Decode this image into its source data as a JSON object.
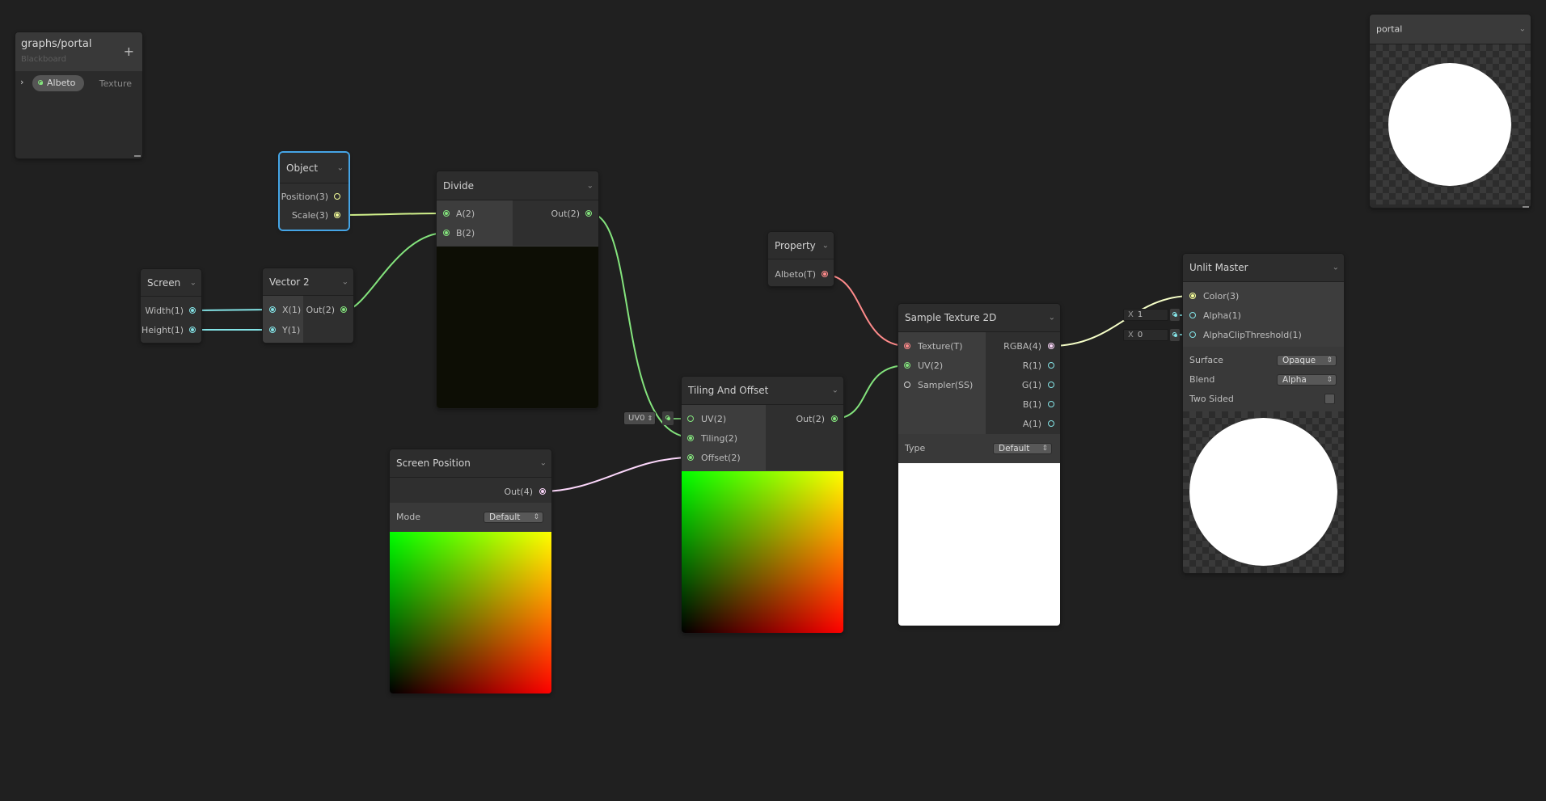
{
  "blackboard": {
    "title": "graphs/portal",
    "subtitle": "Blackboard",
    "add_label": "+",
    "property": {
      "name": "Albeto",
      "type": "Texture"
    }
  },
  "main_preview": {
    "title": "portal"
  },
  "nodes": {
    "object": {
      "title": "Object",
      "outputs": [
        "Position(3)",
        "Scale(3)"
      ]
    },
    "screen": {
      "title": "Screen",
      "outputs": [
        "Width(1)",
        "Height(1)"
      ]
    },
    "vector2": {
      "title": "Vector 2",
      "inputs": [
        "X(1)",
        "Y(1)"
      ],
      "output": "Out(2)"
    },
    "divide": {
      "title": "Divide",
      "inputs": [
        "A(2)",
        "B(2)"
      ],
      "output": "Out(2)"
    },
    "property": {
      "title": "Property",
      "output": "Albeto(T)"
    },
    "sample_texture": {
      "title": "Sample Texture 2D",
      "inputs": [
        "Texture(T)",
        "UV(2)",
        "Sampler(SS)"
      ],
      "outputs": [
        "RGBA(4)",
        "R(1)",
        "G(1)",
        "B(1)",
        "A(1)"
      ],
      "type_label": "Type",
      "type_value": "Default"
    },
    "tiling_offset": {
      "title": "Tiling And Offset",
      "inputs": [
        "UV(2)",
        "Tiling(2)",
        "Offset(2)"
      ],
      "output": "Out(2)",
      "uv_field": "UV0"
    },
    "screen_position": {
      "title": "Screen Position",
      "output": "Out(4)",
      "mode_label": "Mode",
      "mode_value": "Default"
    },
    "unlit_master": {
      "title": "Unlit Master",
      "inputs": [
        "Color(3)",
        "Alpha(1)",
        "AlphaClipThreshold(1)"
      ],
      "alpha_field": {
        "label": "X",
        "value": "1"
      },
      "clip_field": {
        "label": "X",
        "value": "0"
      },
      "settings": [
        {
          "label": "Surface",
          "value": "Opaque"
        },
        {
          "label": "Blend",
          "value": "Alpha"
        },
        {
          "label": "Two Sided",
          "value": ""
        }
      ]
    }
  },
  "colors": {
    "background": "#202020",
    "wire_vector2": "#84e47d",
    "wire_float": "#84e4e7",
    "wire_vector3": "#f6ff9a",
    "wire_vector4": "#fcd7fb",
    "wire_texture": "#ff8b8b",
    "selection": "#45a5e6"
  }
}
